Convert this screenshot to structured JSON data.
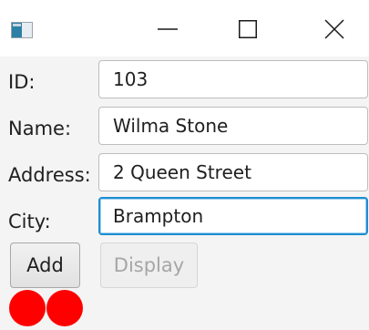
{
  "window": {
    "icons": {
      "app": "app-window-icon",
      "minimize": "minimize-icon",
      "maximize": "maximize-icon",
      "close": "close-icon"
    }
  },
  "form": {
    "fields": [
      {
        "label": "ID:",
        "value": "103"
      },
      {
        "label": "Name:",
        "value": "Wilma Stone"
      },
      {
        "label": "Address:",
        "value": "2 Queen Street"
      },
      {
        "label": "City:",
        "value": "Brampton"
      }
    ],
    "buttons": {
      "add_label": "Add",
      "display_label": "Display"
    }
  },
  "indicators": {
    "color": "#ff0000",
    "count": 2
  },
  "colors": {
    "focus": "#1e8ed1",
    "disabled_text": "#a6a6a6"
  }
}
